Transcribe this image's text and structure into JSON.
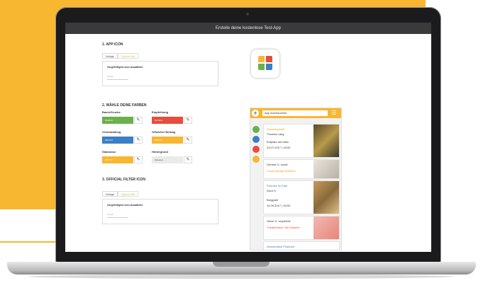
{
  "window": {
    "title": "Erstelle deine kostenlose Test-App"
  },
  "sections": {
    "app_icon": {
      "heading": "1. APP ICON",
      "tabs": [
        "Vorlage",
        "Eigenes Bild"
      ],
      "panel_label": "Vorgefertigtes Icon auswählen",
      "input_placeholder": "Finden"
    },
    "colors": {
      "heading": "2. WÄHLE DEINE FARBEN",
      "items": [
        {
          "label": "Basis/Gruebe",
          "value": "#6ab04c",
          "color": "#6ab04c"
        },
        {
          "label": "Empfehlung",
          "value": "#e74c3c",
          "color": "#e74c3c"
        },
        {
          "label": "Veranstaltung",
          "value": "#3b7fc4",
          "color": "#3b7fc4"
        },
        {
          "label": "Offizieller Beitrag",
          "value": "#f7b731",
          "color": "#f7b731"
        },
        {
          "label": "Statusbox",
          "value": "#f7b731",
          "color": "#f7b731"
        },
        {
          "label": "Hintergrund",
          "value": "#eaeaea",
          "color": "#eaeaea"
        }
      ]
    },
    "filter_icon": {
      "heading": "3. OFFICIAL FILTER ICON",
      "tabs": [
        "Vorlage",
        "Eigenes Bild"
      ],
      "panel_label": "Vorgefertigtes Icon auswählen",
      "input_placeholder": "Finden"
    }
  },
  "phone": {
    "search_placeholder": "App durchsuchen...",
    "cards": [
      {
        "title": "Gemeinschaft",
        "sub": "Thomas Lang",
        "line1": "Entplatz am Main",
        "line2": "23.07.2017 | 18:00"
      },
      {
        "title": "Gehard G. sucht:",
        "sub": "Lesewuerdige Buecher"
      },
      {
        "title": "Picknick im Park",
        "sub": "Dora H.",
        "line1": "Burgpark",
        "line2": "14.09.2017 | 18:00"
      },
      {
        "title": "Oliver H. empfiehlt:",
        "sub": "Theaterstück \"Die Räuber\""
      },
      {
        "title": "Deutschland Postcard"
      }
    ]
  },
  "colors": {
    "accent": "#f7b731",
    "frame": "#1b1b1d"
  }
}
